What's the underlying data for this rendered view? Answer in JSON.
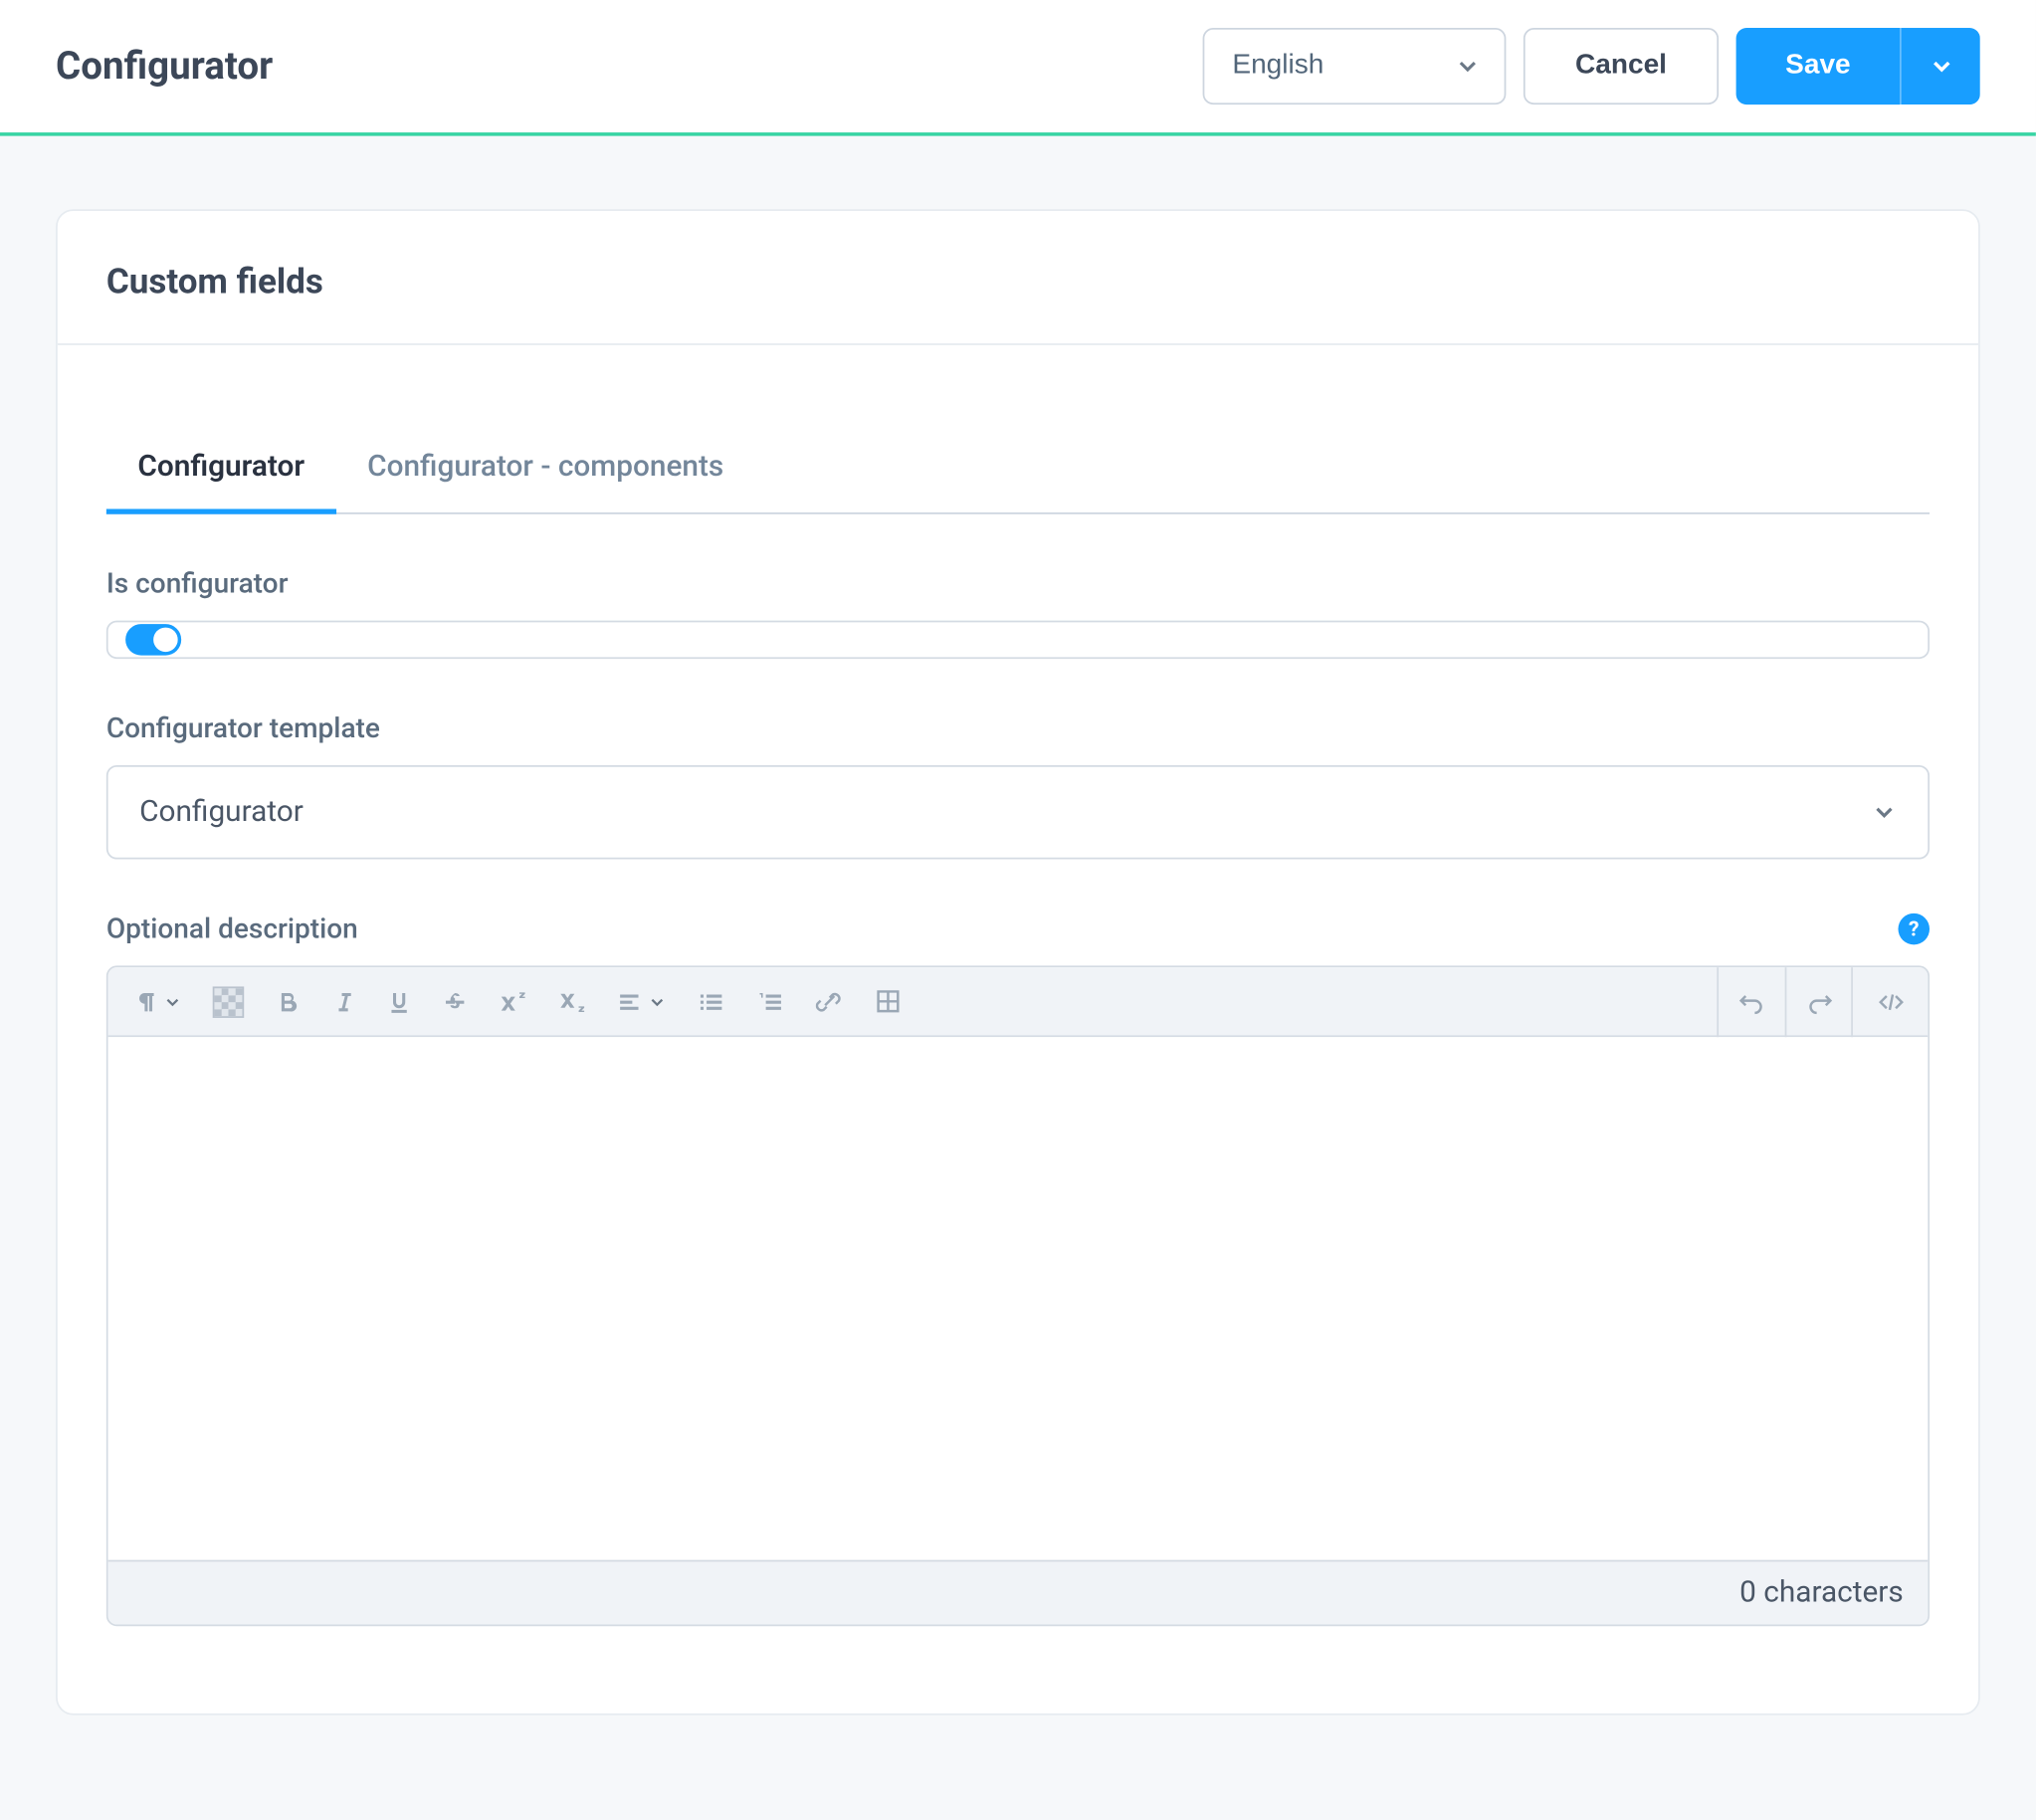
{
  "header": {
    "title": "Configurator",
    "language": "English",
    "cancel": "Cancel",
    "save": "Save"
  },
  "card": {
    "title": "Custom fields"
  },
  "tabs": [
    {
      "label": "Configurator",
      "active": true
    },
    {
      "label": "Configurator - components",
      "active": false
    }
  ],
  "fields": {
    "is_configurator": {
      "label": "Is configurator",
      "value": true
    },
    "configurator_template": {
      "label": "Configurator template",
      "value": "Configurator"
    },
    "optional_description": {
      "label": "Optional description",
      "char_count_text": "0 characters"
    }
  },
  "editor_toolbar": {
    "paragraph": "paragraph-format-icon",
    "media": "media-icon",
    "bold": "bold-icon",
    "italic": "italic-icon",
    "underline": "underline-icon",
    "strike": "strike-icon",
    "superscript": "superscript-icon",
    "subscript": "subscript-icon",
    "align": "align-icon",
    "list_bullet": "list-bullet-icon",
    "list_number": "list-number-icon",
    "link": "link-icon",
    "table": "table-icon",
    "undo": "undo-icon",
    "redo": "redo-icon",
    "code": "code-icon"
  },
  "icons": {
    "help": "?",
    "chevron_down": "chevron-down-icon"
  }
}
